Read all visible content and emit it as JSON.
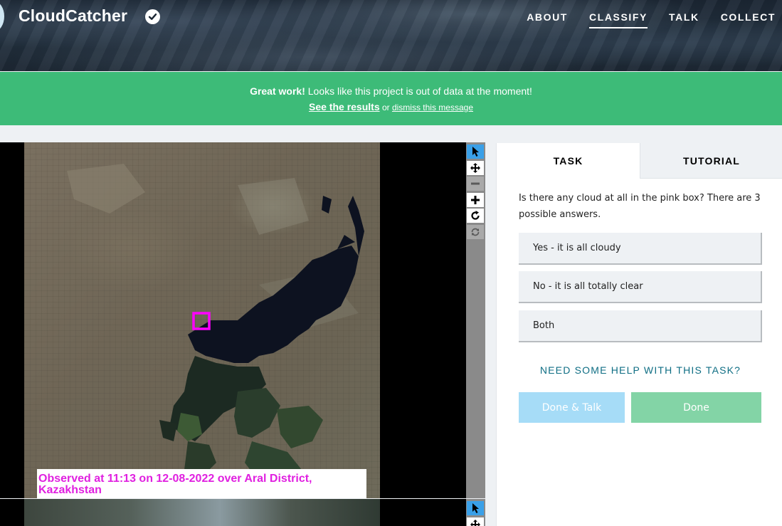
{
  "header": {
    "project_title": "CloudCatcher",
    "verified_icon": "checkmark-badge-icon",
    "nav": [
      {
        "label": "ABOUT",
        "active": false
      },
      {
        "label": "CLASSIFY",
        "active": true
      },
      {
        "label": "TALK",
        "active": false
      },
      {
        "label": "COLLECT",
        "active": false
      }
    ]
  },
  "banner": {
    "strong": "Great work!",
    "message": " Looks like this project is out of data at the moment!",
    "results_link": "See the results",
    "or_text": " or ",
    "dismiss_link": "dismiss this message",
    "color": "#3dbb78"
  },
  "viewer": {
    "observation_label": "Observed at 11:13 on 12-08-2022 over Aral District, Kazakhstan",
    "highlight_color": "#ff00ff",
    "tools": [
      "pointer-icon",
      "pan-icon",
      "zoom-out-icon",
      "zoom-in-icon",
      "rotate-icon",
      "reset-icon"
    ]
  },
  "panel": {
    "tabs": [
      {
        "label": "TASK",
        "active": true
      },
      {
        "label": "TUTORIAL",
        "active": false
      }
    ],
    "question": "Is there any cloud at all in the pink box? There are 3 possible answers.",
    "answers": [
      "Yes - it is all cloudy",
      "No - it is all totally clear",
      "Both"
    ],
    "help_link": "NEED SOME HELP WITH THIS TASK?",
    "done_talk_label": "Done & Talk",
    "done_label": "Done"
  }
}
